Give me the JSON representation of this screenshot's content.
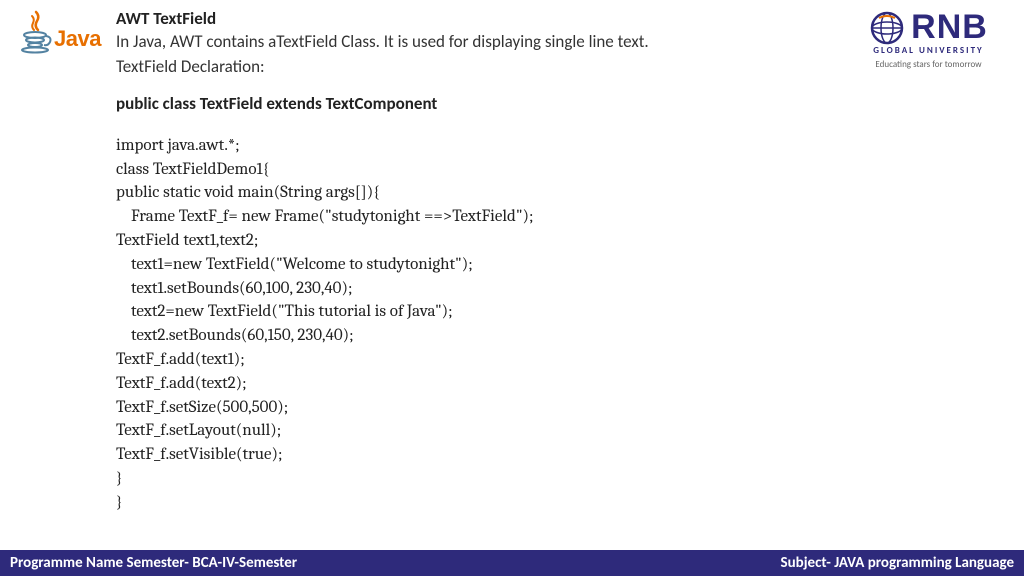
{
  "logo": {
    "javaText": "Java"
  },
  "rnb": {
    "name": "RNB",
    "sub1": "GLOBAL UNIVERSITY",
    "sub2": "Educating stars for tomorrow"
  },
  "doc": {
    "title": "AWT TextField",
    "desc1": "In Java, AWT contains aTextField Class. It is used for displaying single line text.",
    "desc2": "TextField Declaration:",
    "declaration": "public class TextField extends TextComponent",
    "code": "import java.awt.*;\nclass TextFieldDemo1{\npublic static void main(String args[]){\n    Frame TextF_f= new Frame(\"studytonight ==>TextField\");\nTextField text1,text2;\n    text1=new TextField(\"Welcome to studytonight\");\n    text1.setBounds(60,100, 230,40);\n    text2=new TextField(\"This tutorial is of Java\");\n    text2.setBounds(60,150, 230,40);\nTextF_f.add(text1);\nTextF_f.add(text2);\nTextF_f.setSize(500,500);\nTextF_f.setLayout(null);\nTextF_f.setVisible(true);\n}\n}"
  },
  "footer": {
    "left": "Programme Name Semester- BCA-IV-Semester",
    "right": "Subject- JAVA programming Language"
  }
}
